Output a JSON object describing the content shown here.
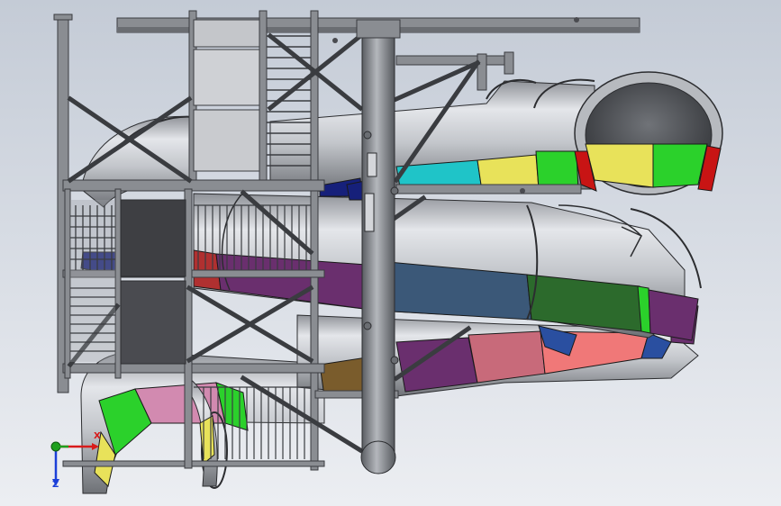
{
  "viewport": {
    "background_top": "#c4cbd6",
    "background_bottom": "#eceef2"
  },
  "model": {
    "subject": "water-slide-tower-assembly",
    "frame_color": "#7a7d82",
    "tube_color": "#c9ccd1",
    "segment_colors": {
      "yellow": "#e8e25a",
      "green": "#2bd12b",
      "red": "#c81414",
      "cyan": "#1fc4c8",
      "navy": "#16207a",
      "purple": "#6a2f6e",
      "steel_blue": "#3b5878",
      "salmon": "#f07878",
      "pink": "#d28ab0",
      "orange": "#d98a3a",
      "blue": "#2a4fa0"
    }
  },
  "triad": {
    "icon": "coordinate-triad-icon",
    "x_label": "X",
    "z_label": "Z",
    "x_color": "#d81b1b",
    "y_color": "#1ea01e",
    "z_color": "#1b3fd8"
  }
}
